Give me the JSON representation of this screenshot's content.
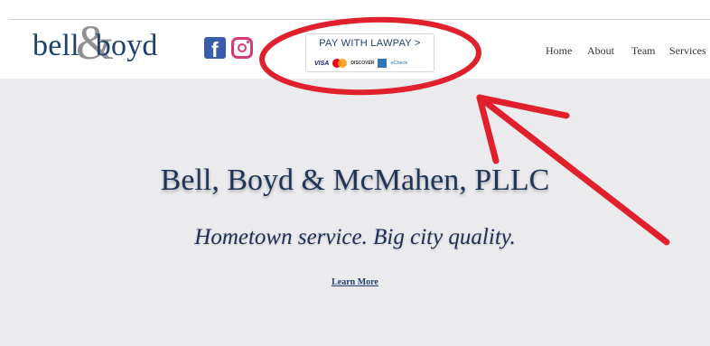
{
  "header": {
    "logo": {
      "part1": "bell",
      "amp": "&",
      "part2": "boyd"
    },
    "social": [
      {
        "icon": "facebook-icon",
        "glyph": "f",
        "color": "#3b5bab"
      },
      {
        "icon": "instagram-icon",
        "color": "#d63a78"
      }
    ],
    "lawpay": {
      "label": "PAY WITH LAWPAY >",
      "cards": {
        "visa": "VISA",
        "discover": "DISCOVER",
        "echeck": "eCheck"
      }
    },
    "nav": [
      {
        "label": "Home"
      },
      {
        "label": "About"
      },
      {
        "label": "Team"
      },
      {
        "label": "Services"
      }
    ]
  },
  "hero": {
    "title": "Bell, Boyd & McMahen, PLLC",
    "subtitle": "Hometown service. Big city quality.",
    "cta": "Learn More"
  },
  "annotation": {
    "color": "#e0202c"
  }
}
